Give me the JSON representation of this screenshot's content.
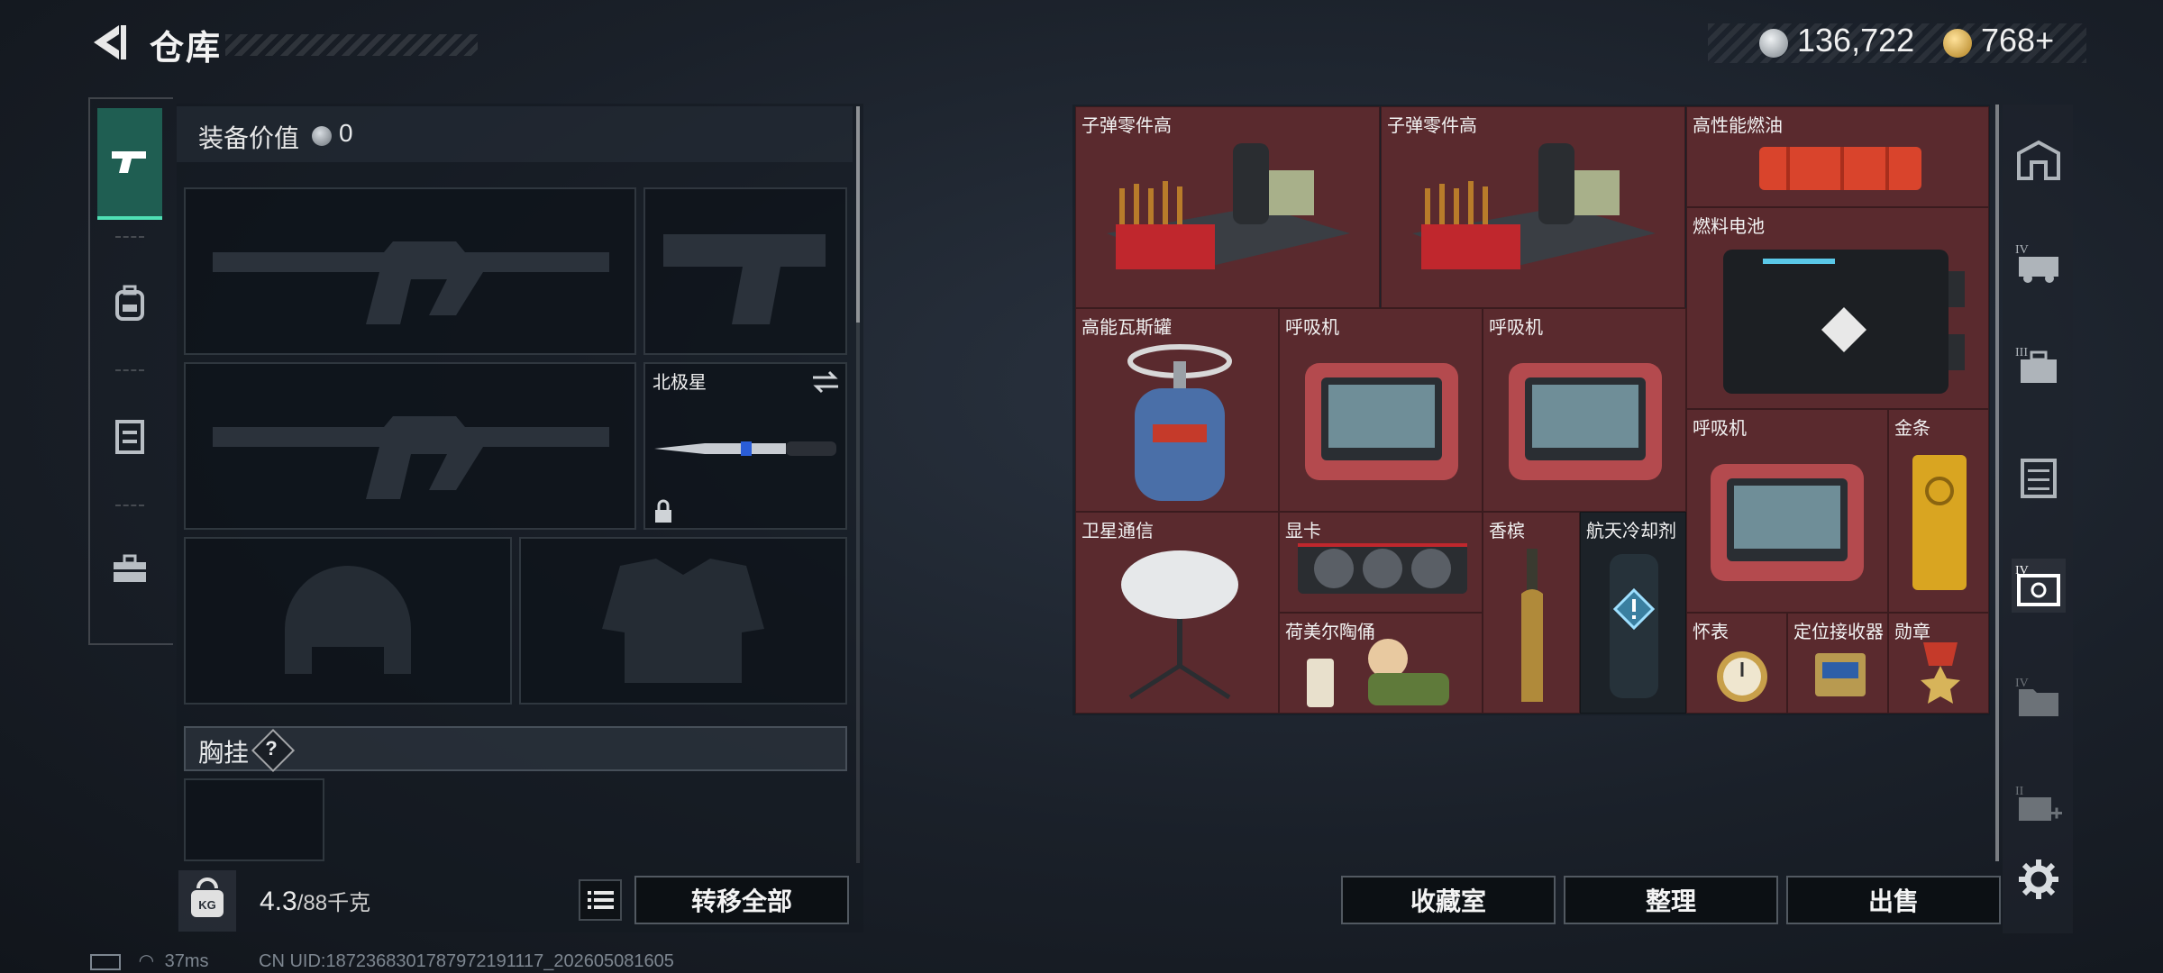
{
  "header": {
    "title": "仓库"
  },
  "currency": {
    "coins": "136,722",
    "premium": "768+",
    "coin_color": "#c9ced3",
    "premium_color": "#d9a93a"
  },
  "equipment": {
    "label": "装备价值",
    "value": "0",
    "melee_slot": {
      "name": "北极星"
    },
    "chest_rig": {
      "label": "胸挂",
      "help": "?"
    }
  },
  "weight": {
    "current": "4.3",
    "max": "/88千克",
    "badge": "KG"
  },
  "buttons": {
    "transfer_all": "转移全部",
    "collection": "收藏室",
    "sort": "整理",
    "sell": "出售"
  },
  "stash_items": [
    {
      "name": "子弹零件高"
    },
    {
      "name": "子弹零件高"
    },
    {
      "name": "高性能燃油"
    },
    {
      "name": "燃料电池"
    },
    {
      "name": "高能瓦斯罐"
    },
    {
      "name": "呼吸机"
    },
    {
      "name": "呼吸机"
    },
    {
      "name": "呼吸机"
    },
    {
      "name": "金条"
    },
    {
      "name": "卫星通信"
    },
    {
      "name": "显卡"
    },
    {
      "name": "香槟"
    },
    {
      "name": "航天冷却剂"
    },
    {
      "name": "荷美尔陶俑"
    },
    {
      "name": "怀表"
    },
    {
      "name": "定位接收器"
    },
    {
      "name": "勋章"
    }
  ],
  "right_rail": {
    "labels": [
      "IV",
      "III",
      "IV",
      "IV",
      "II"
    ]
  },
  "status": {
    "ping": "37ms",
    "uid": "CN UID:1872368301787972191117_202605081605"
  },
  "colors": {
    "accent": "#4fe0b5",
    "cell_red": "#5a2a2e",
    "panel_dark": "#141a21"
  }
}
